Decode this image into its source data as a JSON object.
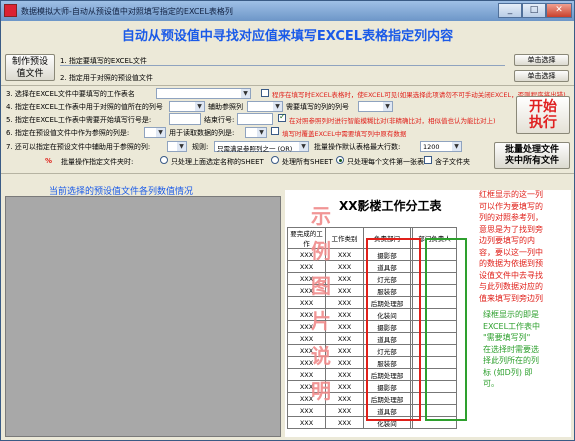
{
  "window": {
    "title": "数据模拟大师-自动从预设值中对照填写指定的EXCEL表格列"
  },
  "heading": "自动从预设值中寻找对应值来填写EXCEL表格指定列内容",
  "left_button": {
    "line1": "制作预设",
    "line2": "值文件"
  },
  "rows": {
    "r1": {
      "label": "1. 指定要填写的EXCEL文件",
      "button": "单击选择"
    },
    "r2": {
      "label": "2. 指定用于对照的预设值文件",
      "button": "单击选择"
    },
    "r3": {
      "label": "3. 选择在EXCEL文件中要填写的工作表名",
      "chk_label": "程序在填写时EXCEL表格时，使EXCEL可见(如果选择此项请勿不可手动关闭EXCEL，否则程序将出错)"
    },
    "r4": {
      "label": "4. 指定在EXCEL工作表中用于对照的值所在的列号",
      "label2": "辅助参照列",
      "label3": "需要填写的列的列号"
    },
    "r5": {
      "label": "5. 指定在EXCEL工作表中需要开始填写行号是:",
      "label2": "结束行号:",
      "chk_label": "在对照参照列时进行智能模糊比对(非精确比对，相似值也认为能比对上)"
    },
    "r6": {
      "label": "6. 指定在预设值文件中作为参照的列是:",
      "label2": "用于读取数据的列是:",
      "chk_label": "填写时覆盖EXCEL中需要填写列中原有数据"
    },
    "r7": {
      "label": "7. 还可以指定在预设文件中辅助用于参照的列:",
      "label2": "规则:",
      "rule_value": "只需满足参照列之一 (OR)",
      "label3": "批量操作默认表格最大行数:",
      "maxrows": "1200"
    },
    "r8": {
      "mark": "%",
      "label": "批量操作指定文件夹时:",
      "opt1": "只处理上面选定名称的SHEET",
      "opt2": "处理所有SHEET",
      "opt3": "只处理每个文件第一张表",
      "chk_label": "含子文件夹"
    }
  },
  "start_button": {
    "line1": "开始",
    "line2": "执行"
  },
  "batch_button": {
    "line1": "批量处理文件",
    "line2": "夹中所有文件"
  },
  "left_panel_title": "当前选择的预设值文件各列数值情况",
  "sheet": {
    "title": "XX影楼工作分工表",
    "vertical_text": "示例图片说明",
    "headers": [
      "要完成的工作",
      "工作类别",
      "负责部门",
      "",
      "部门负责人"
    ],
    "rows": [
      [
        "XXX",
        "XXX",
        "摄影部"
      ],
      [
        "XXX",
        "XXX",
        "道具部"
      ],
      [
        "XXX",
        "XXX",
        "灯光部"
      ],
      [
        "XXX",
        "XXX",
        "服装部"
      ],
      [
        "XXX",
        "XXX",
        "后期处理部"
      ],
      [
        "XXX",
        "XXX",
        "化装间"
      ],
      [
        "XXX",
        "XXX",
        "摄影部"
      ],
      [
        "XXX",
        "XXX",
        "道具部"
      ],
      [
        "XXX",
        "XXX",
        "灯光部"
      ],
      [
        "XXX",
        "XXX",
        "服装部"
      ],
      [
        "XXX",
        "XXX",
        "后期处理部"
      ],
      [
        "XXX",
        "XXX",
        "摄影部"
      ],
      [
        "XXX",
        "XXX",
        "后期处理部"
      ],
      [
        "XXX",
        "XXX",
        "道具部"
      ],
      [
        "XXX",
        "XXX",
        "化装间"
      ]
    ],
    "annotation_red": [
      "红框显示的这一列",
      "可以作为要填写的",
      "列的对照参考列，",
      "意思是为了找到旁",
      "边列要填写的内",
      "容，要以这一列中",
      "的数据为依据到预",
      "设值文件中去寻找",
      "与此列数据对应的",
      "值来填写到旁边列"
    ],
    "annotation_green": [
      "绿框显示的即是",
      "EXCEL工作表中",
      "\"需要填写列\"",
      "在选择时需要选",
      "择此列所在的列",
      "标 (如D列) 即",
      "可。"
    ]
  },
  "colors": {
    "heading": "#1a5ae8",
    "red_box": "#e0201a",
    "green_box": "#2ea02e",
    "vertical_text": "#f08a8a"
  }
}
